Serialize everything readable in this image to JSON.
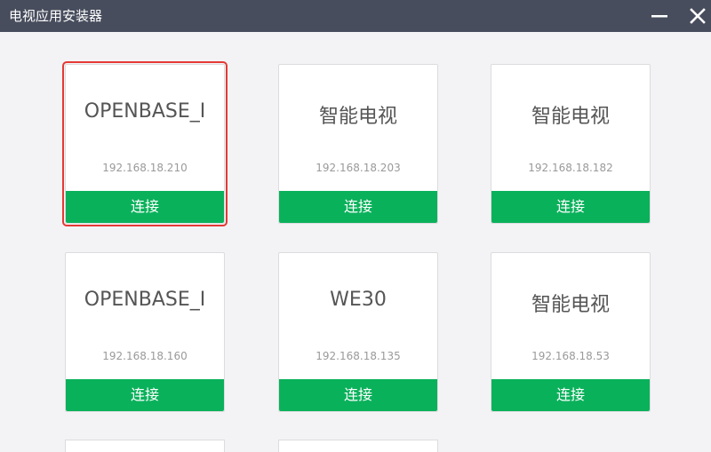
{
  "window": {
    "title": "电视应用安装器",
    "minimize_icon": "minimize-icon",
    "close_icon": "close-icon"
  },
  "devices": [
    {
      "name": "OPENBASE_I",
      "ip": "192.168.18.210",
      "action": "连接",
      "selected": true
    },
    {
      "name": "智能电视",
      "ip": "192.168.18.203",
      "action": "连接",
      "selected": false
    },
    {
      "name": "智能电视",
      "ip": "192.168.18.182",
      "action": "连接",
      "selected": false
    },
    {
      "name": "OPENBASE_I",
      "ip": "192.168.18.160",
      "action": "连接",
      "selected": false
    },
    {
      "name": "WE30",
      "ip": "192.168.18.135",
      "action": "连接",
      "selected": false
    },
    {
      "name": "智能电视",
      "ip": "192.168.18.53",
      "action": "连接",
      "selected": false
    }
  ],
  "colors": {
    "titlebar": "#474d5c",
    "connect_button": "#0ab15b",
    "selected_outline": "#e53935"
  }
}
